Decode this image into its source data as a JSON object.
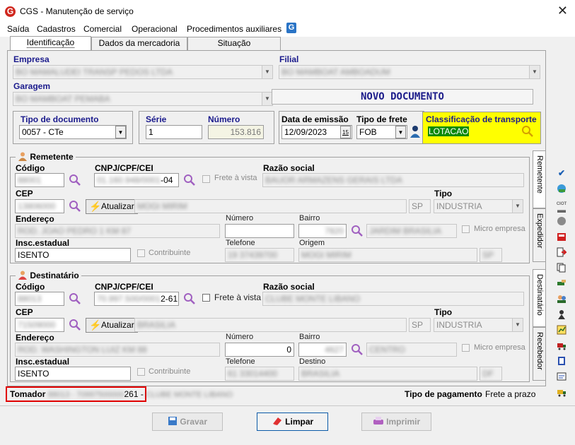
{
  "window": {
    "title": "CGS - Manutenção de serviço",
    "app_icon": "G"
  },
  "menu": [
    "Saída",
    "Cadastros",
    "Comercial",
    "Operacional",
    "Procedimentos auxiliares"
  ],
  "tabs": [
    "Identificação",
    "Dados da mercadoria",
    "Situação"
  ],
  "empresa": {
    "label": "Empresa",
    "value": "BO MAMALUDEI TRANSP PEDOS LTDA"
  },
  "filial": {
    "label": "Filial",
    "value": "BO MAMBOAT AMBOADUM"
  },
  "garagem": {
    "label": "Garagem",
    "value": "BO MAMBOAT PEMABA"
  },
  "status_banner": "NOVO DOCUMENTO",
  "documento": {
    "tipo_label": "Tipo de documento",
    "tipo_value": "0057 - CTe",
    "serie_label": "Série",
    "serie_value": "1",
    "numero_label": "Número",
    "numero_value": "153.816",
    "emissao_label": "Data de emissão",
    "emissao_value": "12/09/2023",
    "calendar_glyph": "15",
    "frete_label": "Tipo de frete",
    "frete_value": "FOB",
    "classificacao_label": "Classificação de transporte",
    "classificacao_value": "LOTACAO"
  },
  "remetente": {
    "title": "Remetente",
    "codigo_label": "Código",
    "codigo_value": "88001",
    "cnpj_label": "CNPJ/CPF/CEI",
    "cnpj_blur": "01.160.948/0001",
    "cnpj_suffix": "-04",
    "frete_vista": "Frete à vista",
    "razao_label": "Razão social",
    "razao_value": "BAUOR ARMAZENS GERAIS LTDA",
    "cep_label": "CEP",
    "cep_value": "13806000",
    "atualizar": "Atualizar",
    "cidade_value": "MOGI MIRIM",
    "uf_value": "SP",
    "tipo_label": "Tipo",
    "tipo_value": "INDUSTRIA",
    "endereco_label": "Endereço",
    "endereco_value": "ROD. JOAO PEDRO 1 KM 87",
    "numero_label": "Número",
    "numero_value": "",
    "bairro_label": "Bairro",
    "bairro_code": "7820",
    "bairro_value": "JARDIM BRASILIA",
    "micro": "Micro empresa",
    "ie_label": "Insc.estadual",
    "ie_value": "ISENTO",
    "contribuinte": "Contribuinte",
    "telefone_label": "Telefone",
    "telefone_value": "19 37439700",
    "origem_label": "Origem",
    "origem_value": "MOGI MIRIM",
    "origem_uf": "SP"
  },
  "destinatario": {
    "title": "Destinatário",
    "codigo_label": "Código",
    "codigo_value": "88013",
    "cnpj_label": "CNPJ/CPF/CEI",
    "cnpj_blur": "70.997.500/0001",
    "cnpj_suffix": "2-61",
    "frete_vista": "Frete à vista",
    "razao_label": "Razão social",
    "razao_value": "CLUBE MONTE LIBANO",
    "cep_label": "CEP",
    "cep_value": "71509000",
    "atualizar": "Atualizar",
    "cidade_value": "BRASILIA",
    "uf_value": "SP",
    "tipo_label": "Tipo",
    "tipo_value": "INDUSTRIA",
    "endereco_label": "Endereço",
    "endereco_value": "ROD. WASHINGTON LUIZ    KM 88",
    "numero_label": "Número",
    "numero_value": "0",
    "bairro_label": "Bairro",
    "bairro_code": "4627",
    "bairro_value": "CENTRO",
    "micro": "Micro empresa",
    "ie_label": "Insc.estadual",
    "ie_value": "ISENTO",
    "contribuinte": "Contribuinte",
    "telefone_label": "Telefone",
    "telefone_value": "61 33014400",
    "destino_label": "Destino",
    "destino_value": "BRASILIA",
    "destino_uf": "DF"
  },
  "side_tabs": [
    "Remetente",
    "Expedidor",
    "Destinatário",
    "Recebedor"
  ],
  "tomador": {
    "label": "Tomador",
    "blur": "88013 - 70997500000",
    "suffix": "261 -",
    "blur2": "CLUBE MONTE LIBANO"
  },
  "pagamento": {
    "label": "Tipo de pagamento",
    "value": "Frete a prazo"
  },
  "buttons": {
    "gravar": "Gravar",
    "limpar": "Limpar",
    "imprimir": "Imprimir"
  },
  "sidebar_icons": [
    "check-icon",
    "globe-icon",
    "ciot-icon",
    "circle-icon",
    "box-icon",
    "doc-arrow-icon",
    "copy-icon",
    "hand-icon",
    "people-icon",
    "person-icon",
    "chart-icon",
    "truck-icon",
    "book-icon",
    "phone-icon",
    "truck2-icon"
  ],
  "ciot_label": "CIOT"
}
